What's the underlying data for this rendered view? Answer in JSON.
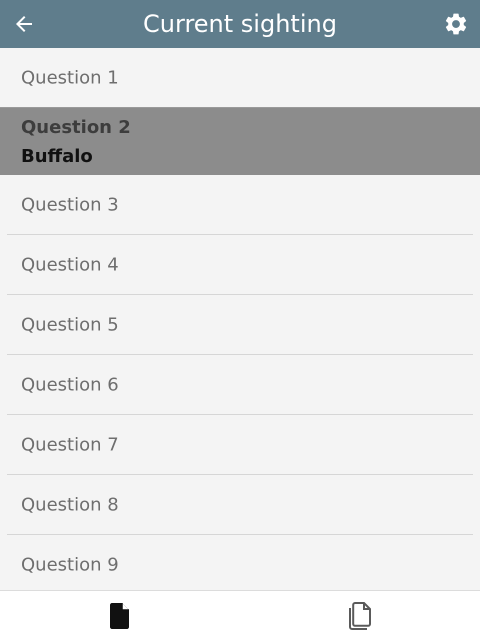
{
  "header": {
    "title": "Current sighting",
    "back_icon": "arrow-left-icon",
    "settings_icon": "gear-icon",
    "background_color": "#5f7d8c"
  },
  "questions": [
    {
      "label": "Question 1"
    },
    {
      "label": "Question 2",
      "answer": "Buffalo",
      "selected": true
    },
    {
      "label": "Question 3"
    },
    {
      "label": "Question 4"
    },
    {
      "label": "Question 5"
    },
    {
      "label": "Question 6"
    },
    {
      "label": "Question 7"
    },
    {
      "label": "Question 8"
    },
    {
      "label": "Question 9"
    }
  ],
  "bottom_bar": {
    "tabs": [
      {
        "icon": "document-icon",
        "active": true
      },
      {
        "icon": "copy-icon",
        "active": false
      }
    ]
  }
}
